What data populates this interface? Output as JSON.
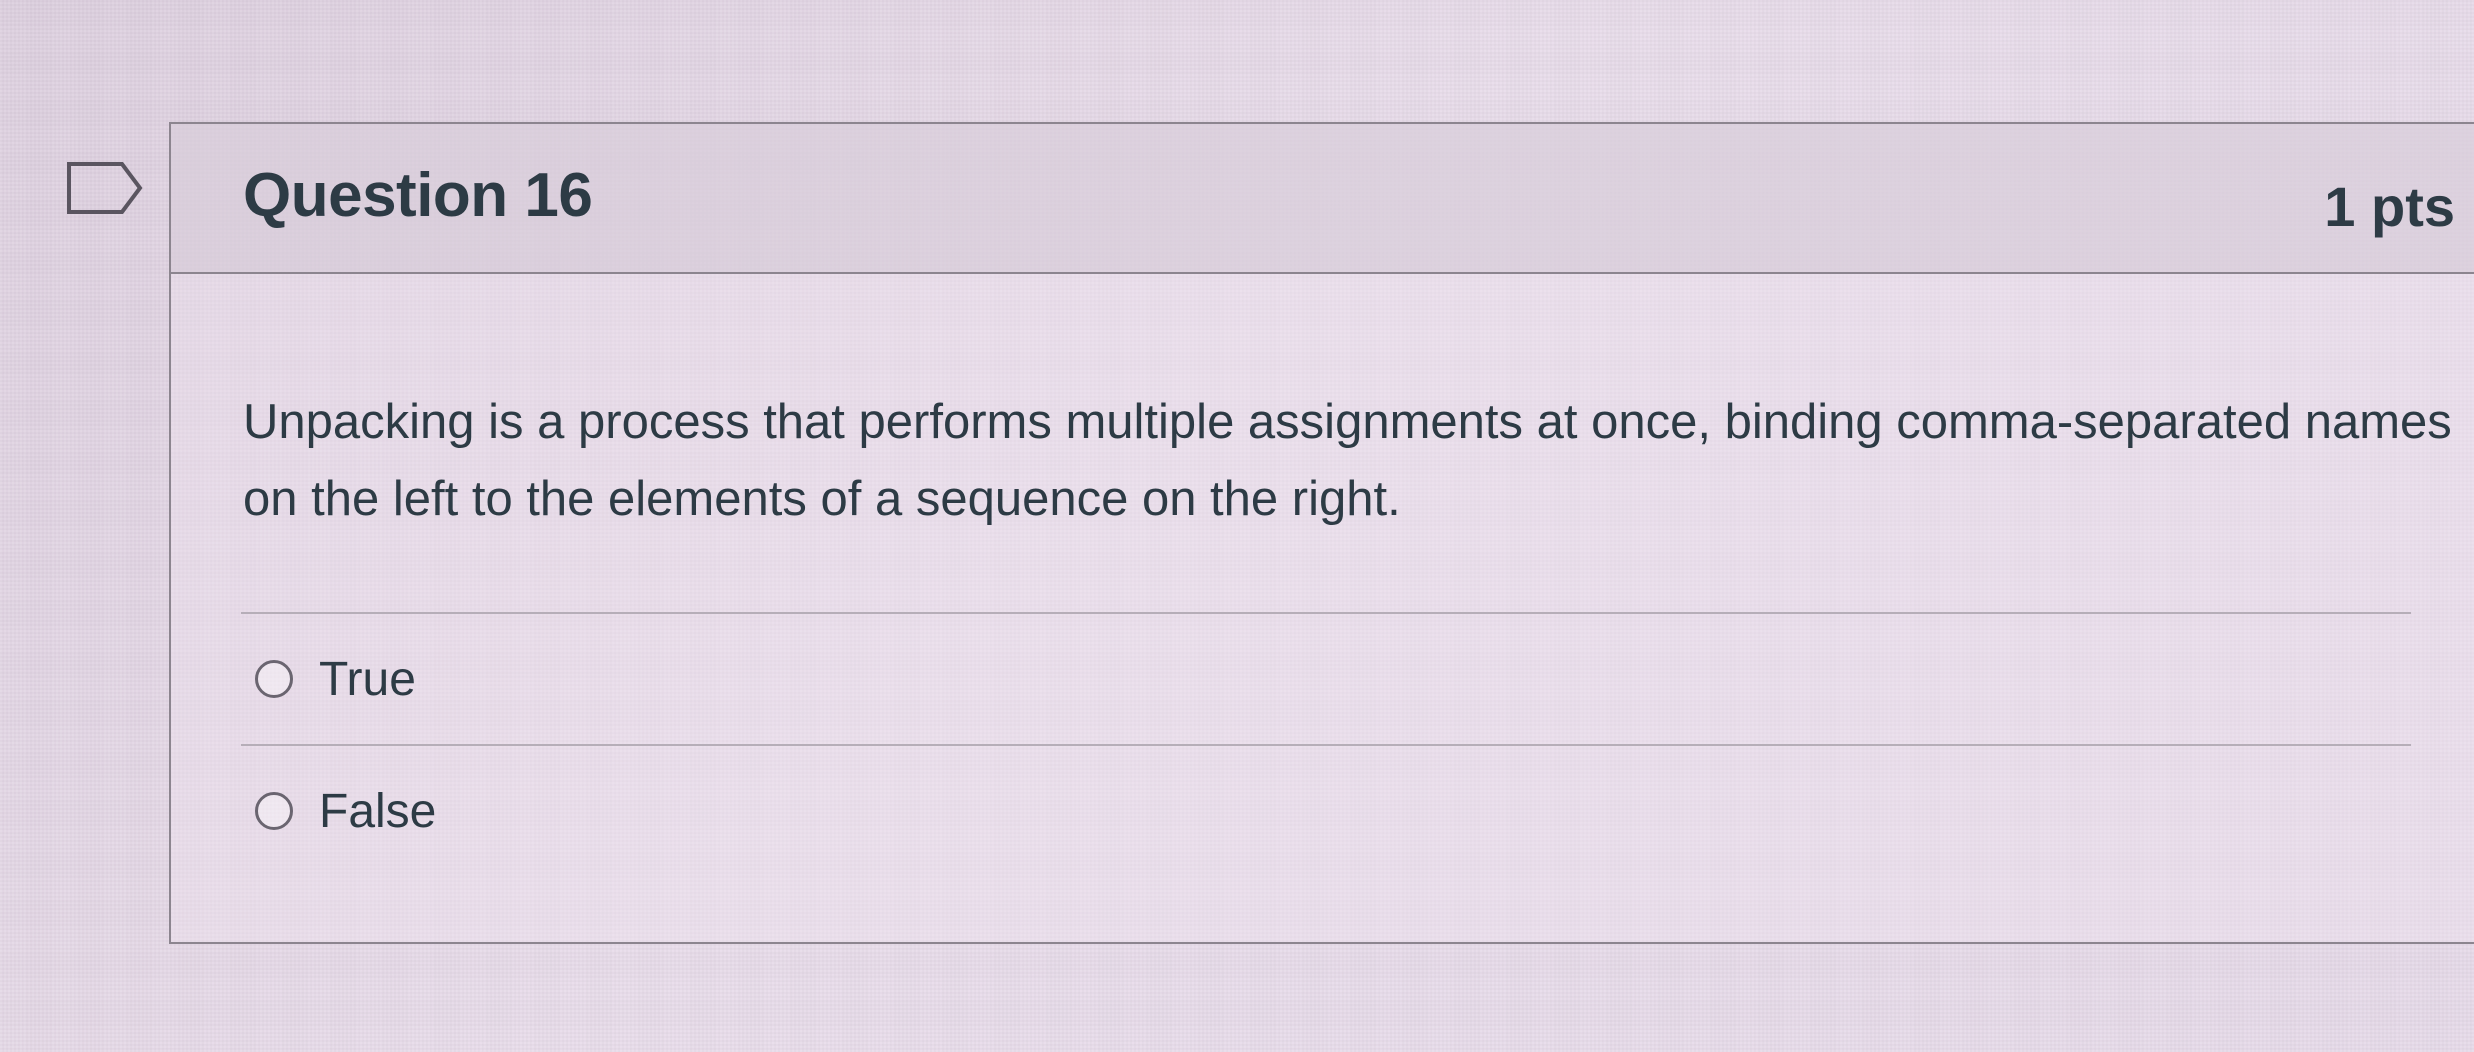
{
  "question": {
    "title": "Question 16",
    "points": "1 pts",
    "text": "Unpacking is a process that performs multiple assignments at once, binding comma-separated names on the left to the elements of a sequence on the right.",
    "answers": [
      {
        "label": "True",
        "selected": false
      },
      {
        "label": "False",
        "selected": false
      }
    ]
  },
  "icons": {
    "flag": "flag-question-icon"
  },
  "colors": {
    "text": "#2d3b45",
    "border": "#8c858f",
    "header_bg": "#d2c6d4",
    "page_bg": "#e5d9e8"
  }
}
